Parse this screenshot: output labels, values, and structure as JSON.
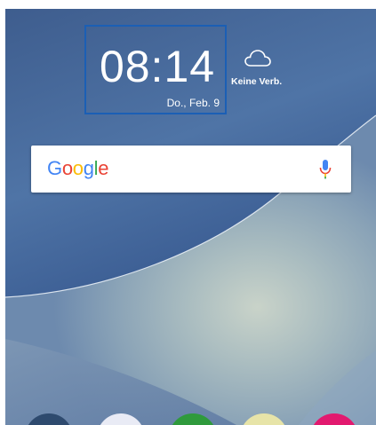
{
  "clock": {
    "time": "08:14",
    "date": "Do., Feb. 9"
  },
  "weather": {
    "icon": "cloud-icon",
    "status": "Keine Verb."
  },
  "search": {
    "logo_letters": [
      {
        "char": "G",
        "color": "#4285F4"
      },
      {
        "char": "o",
        "color": "#EA4335"
      },
      {
        "char": "o",
        "color": "#FBBC05"
      },
      {
        "char": "g",
        "color": "#4285F4"
      },
      {
        "char": "l",
        "color": "#34A853"
      },
      {
        "char": "e",
        "color": "#EA4335"
      }
    ],
    "mic_icon": "microphone-icon"
  },
  "dock": {
    "apps": [
      {
        "icon": "app-icon-dark",
        "color": "#2e4a6e"
      },
      {
        "icon": "app-icon-light",
        "color": "#e9ebf5"
      },
      {
        "icon": "app-icon-green",
        "color": "#2f9a3c"
      },
      {
        "icon": "app-icon-yellow",
        "color": "#e7e4a8"
      },
      {
        "icon": "app-icon-pink",
        "color": "#e2196f"
      }
    ]
  }
}
